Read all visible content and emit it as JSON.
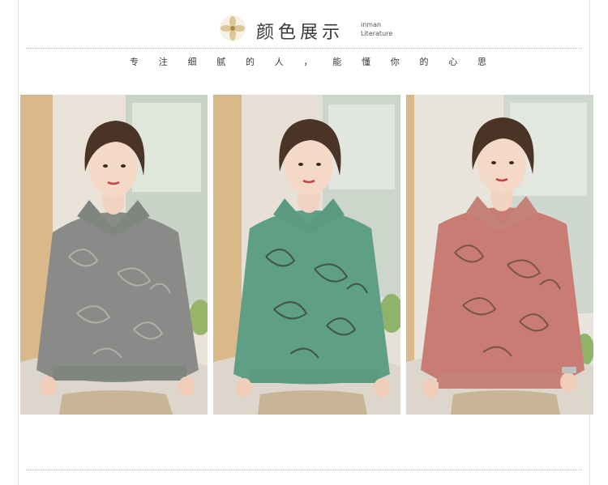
{
  "header": {
    "icon": "flower-icon",
    "title": "颜色展示",
    "subtitle_line1": "inman",
    "subtitle_line2": "Literature"
  },
  "slogan": [
    "专",
    "注",
    "细",
    "腻",
    "的",
    "人",
    "，",
    "能",
    "懂",
    "你",
    "的",
    "心",
    "思"
  ],
  "colors": {
    "frame": "#e2e2e2",
    "dotted_rule": "#c9b987",
    "text": "#3a3a3a"
  },
  "products": [
    {
      "name": "model-photo-gray",
      "top_color": "#8a8a88",
      "collar_color": "#7f8680",
      "pattern_color": "#b8b2ad"
    },
    {
      "name": "model-photo-green",
      "top_color": "#5f9f85",
      "collar_color": "#5a9a80",
      "pattern_color": "#3a4a3a"
    },
    {
      "name": "model-photo-pink",
      "top_color": "#c97c74",
      "collar_color": "#c48278",
      "pattern_color": "#6a4a42"
    }
  ]
}
